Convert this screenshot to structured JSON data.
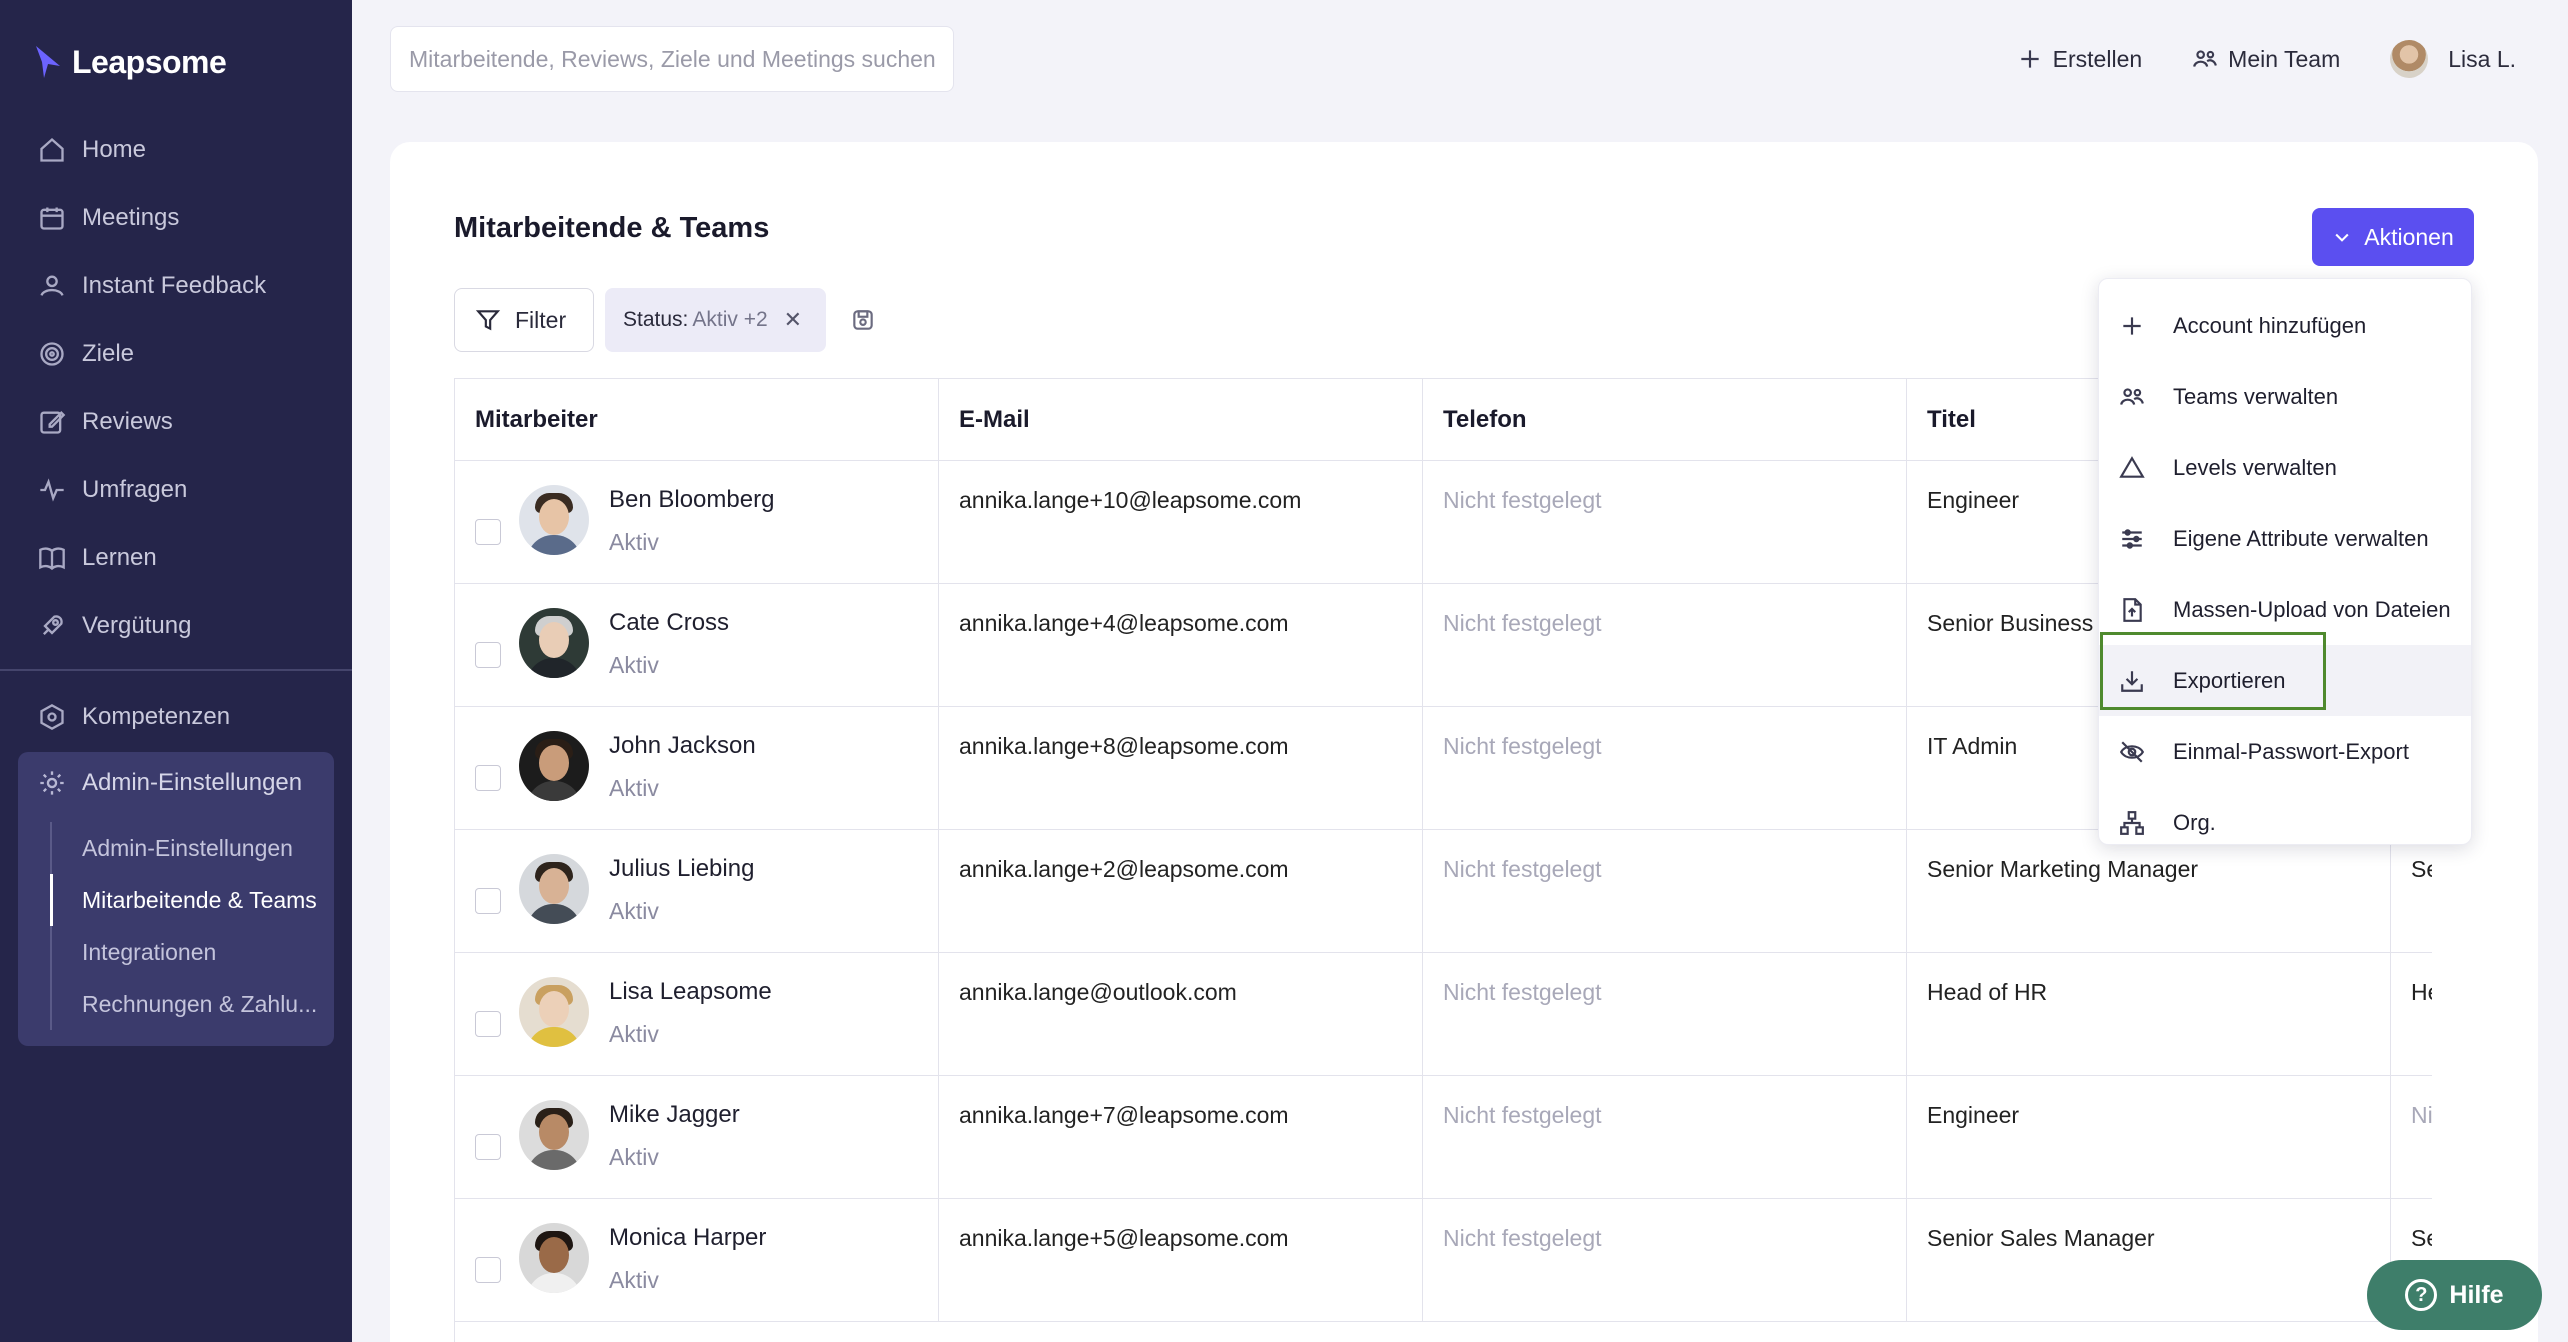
{
  "brand": {
    "name": "Leapsome"
  },
  "sidebar": {
    "items": [
      {
        "label": "Home",
        "icon": "home-icon"
      },
      {
        "label": "Meetings",
        "icon": "calendar-icon"
      },
      {
        "label": "Instant Feedback",
        "icon": "feedback-icon"
      },
      {
        "label": "Ziele",
        "icon": "target-icon"
      },
      {
        "label": "Reviews",
        "icon": "edit-icon"
      },
      {
        "label": "Umfragen",
        "icon": "pulse-icon"
      },
      {
        "label": "Lernen",
        "icon": "book-icon"
      },
      {
        "label": "Vergütung",
        "icon": "rocket-icon"
      }
    ],
    "secondary": [
      {
        "label": "Kompetenzen",
        "icon": "competency-icon"
      }
    ],
    "admin": {
      "label": "Admin-Einstellungen",
      "sub": [
        {
          "label": "Admin-Einstellungen"
        },
        {
          "label": "Mitarbeitende & Teams",
          "active": true
        },
        {
          "label": "Integrationen"
        },
        {
          "label": "Rechnungen & Zahlu..."
        }
      ]
    }
  },
  "topbar": {
    "search_placeholder": "Mitarbeitende, Reviews, Ziele und Meetings suchen",
    "create_label": "Erstellen",
    "team_label": "Mein Team",
    "user_label": "Lisa L."
  },
  "page": {
    "title": "Mitarbeitende & Teams",
    "actions_label": "Aktionen",
    "filter_label": "Filter",
    "chip": {
      "key": "Status:",
      "value": "Aktiv +2"
    }
  },
  "table": {
    "columns": [
      "Mitarbeiter",
      "E-Mail",
      "Telefon",
      "Titel"
    ],
    "rows": [
      {
        "name": "Ben Bloomberg",
        "status": "Aktiv",
        "email": "annika.lange+10@leapsome.com",
        "phone": "Nicht festgelegt",
        "title": "Engineer",
        "extra": ""
      },
      {
        "name": "Cate Cross",
        "status": "Aktiv",
        "email": "annika.lange+4@leapsome.com",
        "phone": "Nicht festgelegt",
        "title": "Senior Business",
        "extra": ""
      },
      {
        "name": "John Jackson",
        "status": "Aktiv",
        "email": "annika.lange+8@leapsome.com",
        "phone": "Nicht festgelegt",
        "title": "IT Admin",
        "extra": ""
      },
      {
        "name": "Julius Liebing",
        "status": "Aktiv",
        "email": "annika.lange+2@leapsome.com",
        "phone": "Nicht festgelegt",
        "title": "Senior Marketing Manager",
        "extra": "Senior"
      },
      {
        "name": "Lisa Leapsome",
        "status": "Aktiv",
        "email": "annika.lange@outlook.com",
        "phone": "Nicht festgelegt",
        "title": "Head of HR",
        "extra": "Head"
      },
      {
        "name": "Mike Jagger",
        "status": "Aktiv",
        "email": "annika.lange+7@leapsome.com",
        "phone": "Nicht festgelegt",
        "title": "Engineer",
        "extra": "Nicht"
      },
      {
        "name": "Monica Harper",
        "status": "Aktiv",
        "email": "annika.lange+5@leapsome.com",
        "phone": "Nicht festgelegt",
        "title": "Senior Sales Manager",
        "extra": "Senior"
      }
    ]
  },
  "actions_menu": {
    "items": [
      {
        "label": "Account hinzufügen",
        "icon": "plus-icon"
      },
      {
        "label": "Teams verwalten",
        "icon": "team-icon"
      },
      {
        "label": "Levels verwalten",
        "icon": "triangle-icon"
      },
      {
        "label": "Eigene Attribute verwalten",
        "icon": "sliders-icon"
      },
      {
        "label": "Massen-Upload von Dateien",
        "icon": "file-upload-icon"
      },
      {
        "label": "Exportieren",
        "icon": "download-icon",
        "highlighted": true
      },
      {
        "label": "Einmal-Passwort-Export",
        "icon": "eye-off-icon"
      },
      {
        "label": "Org.",
        "icon": "org-chart-icon"
      }
    ]
  },
  "help": {
    "label": "Hilfe"
  },
  "colors": {
    "sidebar": "#25254a",
    "accent": "#5b4ff0",
    "help": "#3e7e6a",
    "highlight": "#4f8a2e"
  }
}
